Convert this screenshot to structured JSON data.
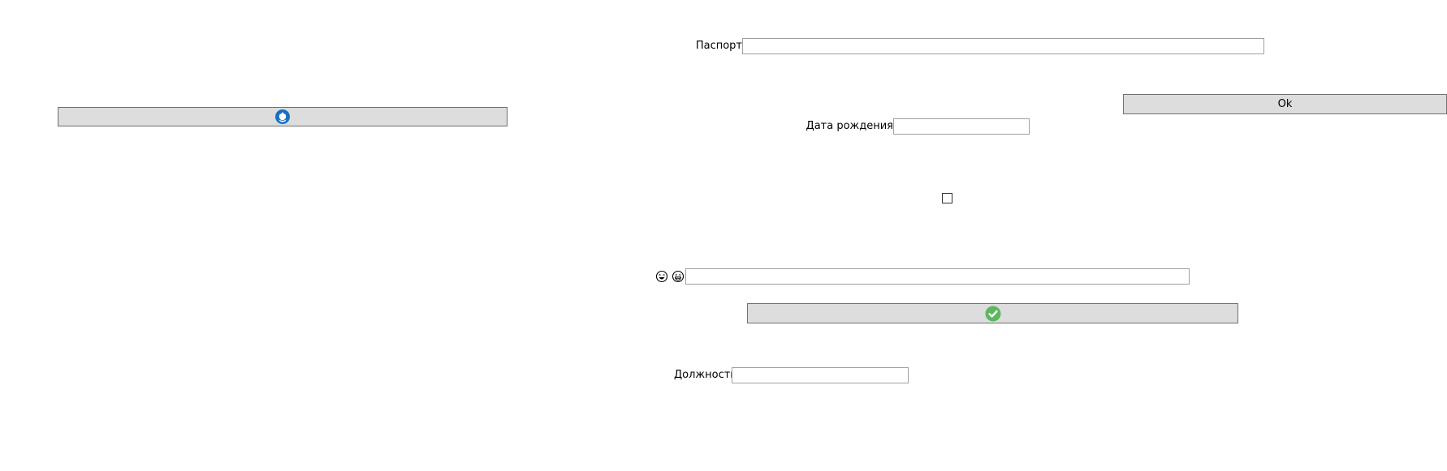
{
  "form": {
    "passport_label": "Паспорт",
    "passport_value": "",
    "ok_button_label": "Ok",
    "birthdate_label": "Дата рождения",
    "birthdate_value": "",
    "checkbox_checked": false,
    "emoji_field_value": "",
    "position_label": "Должность",
    "position_value": ""
  },
  "buttons": {
    "left_icon_button_icon": "lifebuoy-icon",
    "confirm_button_icon": "checkmark-circle-icon"
  },
  "colors": {
    "button_bg": "#dddddd",
    "button_border": "#707070",
    "input_border": "#a0a0a0",
    "lifebuoy_blue": "#1a6fc2",
    "check_green": "#5cb85c"
  },
  "icons": {
    "emoji_1": "laughing-face-icon",
    "emoji_2": "grinning-face-icon"
  }
}
